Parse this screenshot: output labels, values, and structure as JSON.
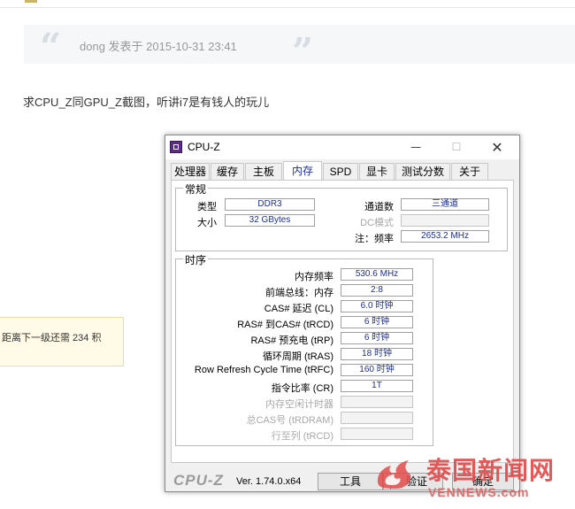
{
  "post": {
    "quote_text": "dong 发表于 2015-10-31 23:41",
    "quote_open": "“",
    "quote_close": "”",
    "body_text": "求CPU_Z同GPU_Z截图，听讲i7是有钱人的玩儿"
  },
  "tooltip": {
    "text": "距离下一级还需 234 积"
  },
  "window": {
    "title": "CPU-Z",
    "minimize_glyph": "—",
    "maximize_glyph": "☐",
    "close_glyph": "✕",
    "tabs": [
      {
        "label": "处理器"
      },
      {
        "label": "缓存"
      },
      {
        "label": "主板"
      },
      {
        "label": "内存"
      },
      {
        "label": "SPD"
      },
      {
        "label": "显卡"
      },
      {
        "label": "测试分数"
      },
      {
        "label": "关于"
      }
    ],
    "active_tab": "内存",
    "general": {
      "title": "常规",
      "type_label": "类型",
      "type_value": "DDR3",
      "size_label": "大小",
      "size_value": "32 GBytes",
      "channels_label": "通道数",
      "channels_value": "三通道",
      "dc_mode_label": "DC模式",
      "dc_mode_value": "",
      "nb_freq_label": "注：频率",
      "nb_freq_value": "2653.2 MHz"
    },
    "timings": {
      "title": "时序",
      "rows": [
        {
          "label": "内存频率",
          "value": "530.6 MHz"
        },
        {
          "label": "前端总线：内存",
          "value": "2:8"
        },
        {
          "label": "CAS# 延迟 (CL)",
          "value": "6.0 时钟"
        },
        {
          "label": "RAS# 到CAS# (tRCD)",
          "value": "6 时钟"
        },
        {
          "label": "RAS# 预充电 (tRP)",
          "value": "6 时钟"
        },
        {
          "label": "循环周期 (tRAS)",
          "value": "18 时钟"
        },
        {
          "label": "Row Refresh Cycle Time (tRFC)",
          "value": "160 时钟"
        },
        {
          "label": "指令比率 (CR)",
          "value": "1T"
        },
        {
          "label": "内存空闲计时器",
          "value": ""
        },
        {
          "label": "总CAS号 (tRDRAM)",
          "value": ""
        },
        {
          "label": "行至列 (tRCD)",
          "value": ""
        }
      ]
    },
    "footer": {
      "logo": "CPU-Z",
      "version": "Ver. 1.74.0.x64",
      "tools_label": "工具",
      "tools_arrow": "▼",
      "validate_label": "验证",
      "ok_label": "确定"
    }
  },
  "watermark": {
    "cn": "泰国新闻网",
    "en": "VENNEWS.com"
  },
  "colors": {
    "value_text": "#1f2f8f",
    "watermark": "#e24b4b"
  }
}
